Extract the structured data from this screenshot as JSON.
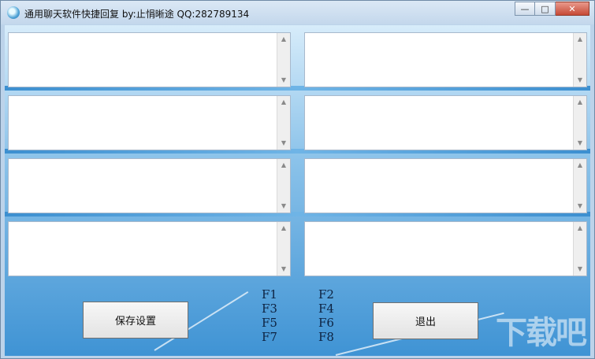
{
  "window": {
    "title": "通用聊天软件快捷回复  by:止悁晰途 QQ:282789134",
    "controls": {
      "minimize": "—",
      "maximize": "□",
      "close": "✕"
    }
  },
  "panels": [
    {
      "value": ""
    },
    {
      "value": ""
    },
    {
      "value": ""
    },
    {
      "value": ""
    },
    {
      "value": ""
    },
    {
      "value": ""
    },
    {
      "value": ""
    },
    {
      "value": ""
    }
  ],
  "hotkeys": [
    "F1",
    "F2",
    "F3",
    "F4",
    "F5",
    "F6",
    "F7",
    "F8"
  ],
  "buttons": {
    "save": "保存设置",
    "exit": "退出"
  },
  "watermark": "下载吧",
  "icons": {
    "app": "app-icon",
    "scroll_up": "scroll-up-icon",
    "scroll_down": "scroll-down-icon"
  }
}
